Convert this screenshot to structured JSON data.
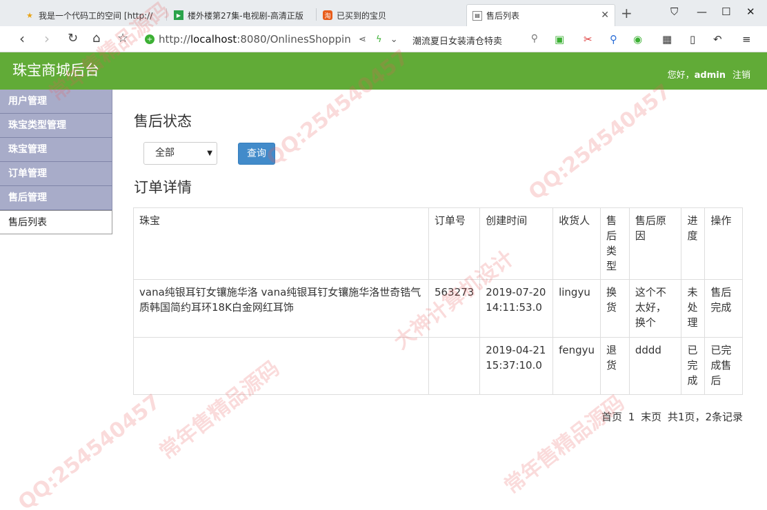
{
  "browser": {
    "tabs": [
      {
        "title": "我是一个代码工的空间 [http://"
      },
      {
        "title": "楼外楼第27集-电视剧-高清正版"
      },
      {
        "title": "已买到的宝贝"
      },
      {
        "title": "售后列表"
      }
    ],
    "url_prefix": "http://",
    "url_host": "localhost",
    "url_rest": ":8080/OnlinesShoppin",
    "search_text": "潮流夏日女装清仓特卖"
  },
  "header": {
    "title": "珠宝商城后台",
    "greeting": "您好，",
    "username": "admin",
    "logout": "注销"
  },
  "sidebar": {
    "items": [
      {
        "label": "用户管理"
      },
      {
        "label": "珠宝类型管理"
      },
      {
        "label": "珠宝管理"
      },
      {
        "label": "订单管理"
      },
      {
        "label": "售后管理"
      },
      {
        "label": "售后列表"
      }
    ]
  },
  "filter": {
    "heading": "售后状态",
    "select_value": "全部",
    "query_label": "查询"
  },
  "orders": {
    "heading": "订单详情",
    "columns": [
      "珠宝",
      "订单号",
      "创建时间",
      "收货人",
      "售后类型",
      "售后原因",
      "进度",
      "操作"
    ],
    "rows": [
      {
        "jewelry": "vana纯银耳钉女镶施华洛  vana纯银耳钉女镶施华洛世奇锆气质韩国简约耳环18K白金网红耳饰",
        "order_no": "563273",
        "created": "2019-07-20 14:11:53.0",
        "receiver": "lingyu",
        "type": "换货",
        "reason": "这个不太好，换个",
        "progress": "未处理",
        "action": "售后完成"
      },
      {
        "jewelry": "",
        "order_no": "",
        "created": "2019-04-21 15:37:10.0",
        "receiver": "fengyu",
        "type": "退货",
        "reason": "dddd",
        "progress": "已完成",
        "action": "已完成售后"
      }
    ]
  },
  "pager": {
    "first": "首页",
    "current": "1",
    "last": "末页",
    "summary": "共1页，2条记录"
  },
  "watermark": {
    "texts": [
      "QQ:254540457",
      "常年售精品源码",
      "大神计算机设计"
    ]
  },
  "colors": {
    "header_green": "#61ab37",
    "sidebar_bg": "#a8acc9",
    "primary_button": "#428bca"
  }
}
